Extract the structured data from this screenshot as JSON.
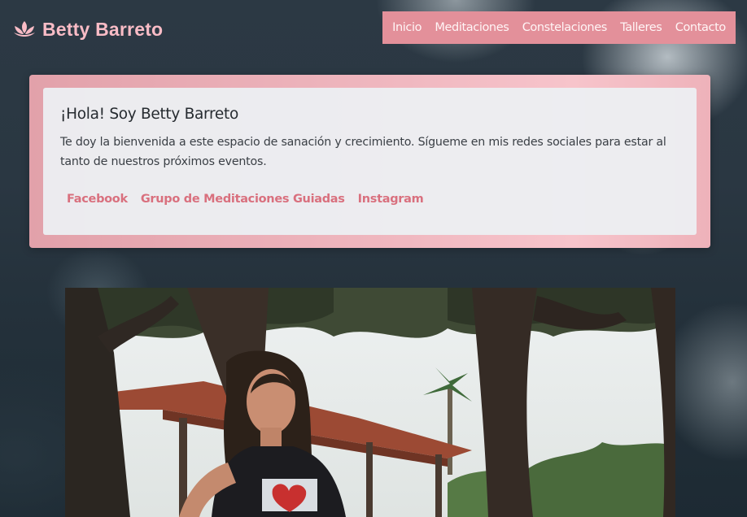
{
  "brand": {
    "name": "Betty Barreto",
    "icon": "lotus-icon"
  },
  "nav": {
    "items": [
      {
        "label": "Inicio"
      },
      {
        "label": "Meditaciones"
      },
      {
        "label": "Constelaciones"
      },
      {
        "label": "Talleres"
      },
      {
        "label": "Contacto"
      }
    ]
  },
  "hero": {
    "title": "¡Hola! Soy Betty Barreto",
    "text": "Te doy la bienvenida a este espacio de sanación y crecimiento. Sígueme en mis redes sociales para estar al tanto de nuestros próximos eventos.",
    "links": [
      {
        "label": "Facebook"
      },
      {
        "label": "Grupo de Meditaciones Guiadas"
      },
      {
        "label": "Instagram"
      }
    ]
  },
  "photo": {
    "subject": "portrait-photo"
  },
  "colors": {
    "brand_pink": "#f9bcc6",
    "nav_bg": "#e3909a",
    "link_pink": "#d9707e",
    "card_bg": "#eceff2",
    "page_bg": "#2a3742"
  }
}
